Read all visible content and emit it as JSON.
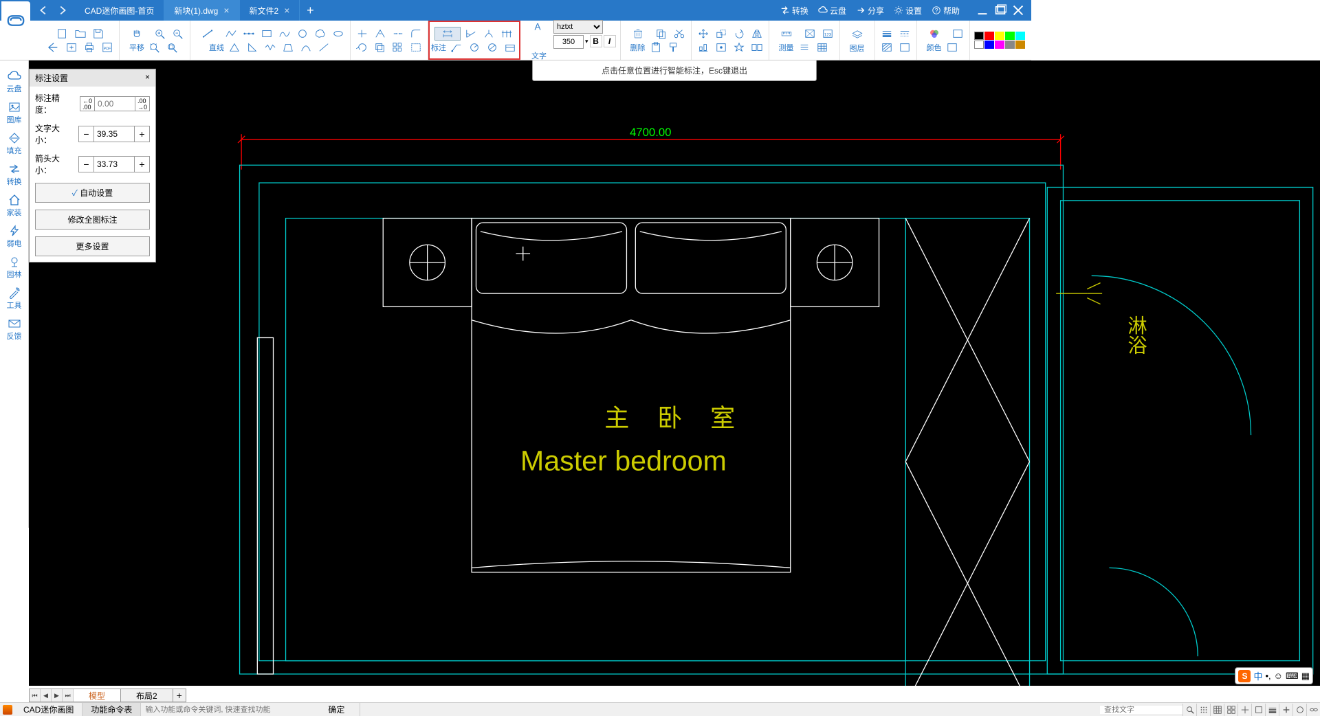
{
  "titlebar": {
    "tabs": [
      {
        "label": "CAD迷你画图-首页",
        "closable": false,
        "active": false
      },
      {
        "label": "新块(1).dwg",
        "closable": true,
        "active": true
      },
      {
        "label": "新文件2",
        "closable": true,
        "active": false
      }
    ],
    "right": {
      "convert": "转换",
      "cloud": "云盘",
      "share": "分享",
      "settings": "设置",
      "help": "帮助"
    }
  },
  "ribbon": {
    "pan": "平移",
    "line": "直线",
    "dim": "标注",
    "text": "文字",
    "font": "hztxt",
    "fontsize": "350",
    "delete": "删除",
    "measure": "测量",
    "layer": "图层",
    "color": "颜色"
  },
  "leftdock": [
    {
      "label": "云盘"
    },
    {
      "label": "图库"
    },
    {
      "label": "填充"
    },
    {
      "label": "转换"
    },
    {
      "label": "家装"
    },
    {
      "label": "弱电"
    },
    {
      "label": "园林"
    },
    {
      "label": "工具"
    },
    {
      "label": "反馈"
    }
  ],
  "hint": "点击任意位置进行智能标注，Esc键退出",
  "settings": {
    "title": "标注设置",
    "precision_label": "标注精度：",
    "precision_value": "0.00",
    "fontsize_label": "文字大小：",
    "fontsize_value": "39.35",
    "arrowsize_label": "箭头大小：",
    "arrowsize_value": "33.73",
    "auto": "自动设置",
    "modify_all": "修改全图标注",
    "more": "更多设置"
  },
  "canvas": {
    "dimension_value": "4700.00",
    "room_label_cn": "主 卧 室",
    "room_label_en": "Master bedroom",
    "bath_label": "淋浴"
  },
  "model_tabs": {
    "model": "模型",
    "layout": "布局2"
  },
  "status": {
    "app": "CAD迷你画图",
    "cmd": "功能命令表",
    "cmd_placeholder": "输入功能或命令关键词, 快速查找功能",
    "ok": "确定",
    "search_placeholder": "查找文字"
  },
  "ime": {
    "s": "S",
    "cn": "中"
  }
}
